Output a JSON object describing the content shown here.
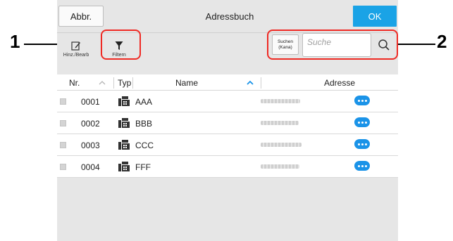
{
  "titlebar": {
    "back_label": "Abbr.",
    "title": "Adressbuch",
    "ok_label": "OK"
  },
  "toolbar": {
    "add_edit_label": "Hinz./Bearb",
    "filter_label": "Filtern",
    "kana_label": "Suchen\n(Kana)",
    "search_placeholder": "Suche"
  },
  "table": {
    "columns": {
      "nr": "Nr.",
      "typ": "Typ",
      "name": "Name",
      "address": "Adresse"
    },
    "rows": [
      {
        "nr": "0001",
        "name": "AAA",
        "type_icon": "fax-icon"
      },
      {
        "nr": "0002",
        "name": "BBB",
        "type_icon": "fax-icon"
      },
      {
        "nr": "0003",
        "name": "CCC",
        "type_icon": "fax-icon"
      },
      {
        "nr": "0004",
        "name": "FFF",
        "type_icon": "fax-icon"
      }
    ]
  },
  "callouts": {
    "one": "1",
    "two": "2"
  },
  "colors": {
    "accent": "#1aa3e6",
    "highlight": "#ef2a24",
    "more_button": "#1a93e8",
    "panel_bg": "#e6e6e6"
  }
}
